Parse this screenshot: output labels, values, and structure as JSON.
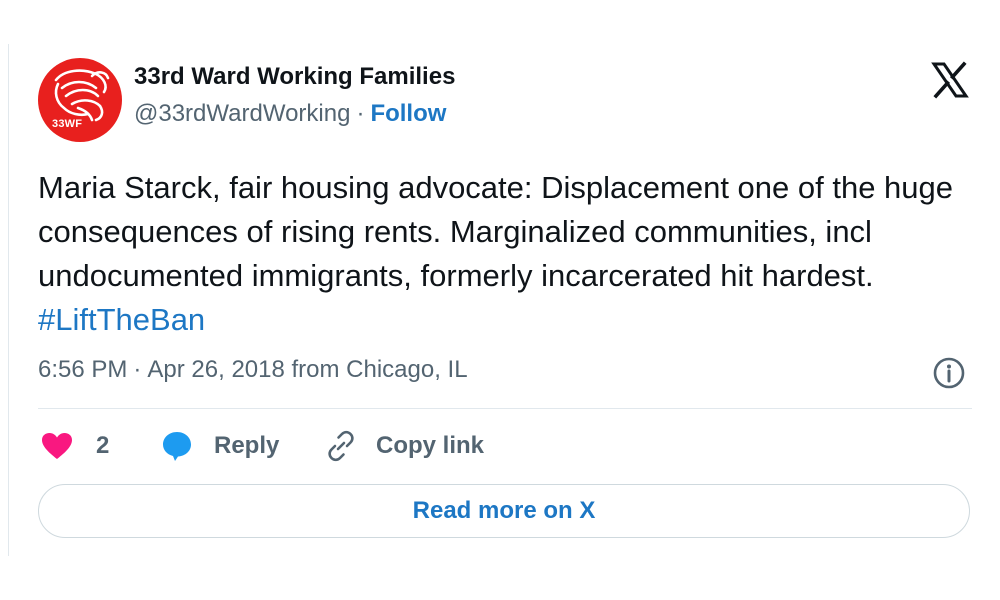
{
  "account": {
    "display_name": "33rd Ward Working Families",
    "handle": "@33rdWardWorking",
    "separator": "·",
    "follow_label": "Follow",
    "avatar_text": "33WF"
  },
  "tweet": {
    "text": "Maria Starck, fair housing advocate: Displacement one of the huge consequences of rising rents. Marginalized communities, incl undocumented immigrants, formerly incarcerated hit hardest.",
    "hashtag": "#LiftTheBan"
  },
  "meta": {
    "time": "6:56 PM",
    "separator": "·",
    "date": "Apr 26, 2018",
    "location": "from Chicago, IL"
  },
  "actions": {
    "like_count": "2",
    "reply_label": "Reply",
    "copy_label": "Copy link"
  },
  "read_more_label": "Read more on X",
  "colors": {
    "accent": "#1d77c4",
    "like": "#f91880",
    "reply": "#1d9bf0",
    "avatar_bg": "#e8201e"
  },
  "icons": [
    "x-logo-icon",
    "info-icon",
    "heart-icon",
    "reply-bubble-icon",
    "link-icon"
  ]
}
